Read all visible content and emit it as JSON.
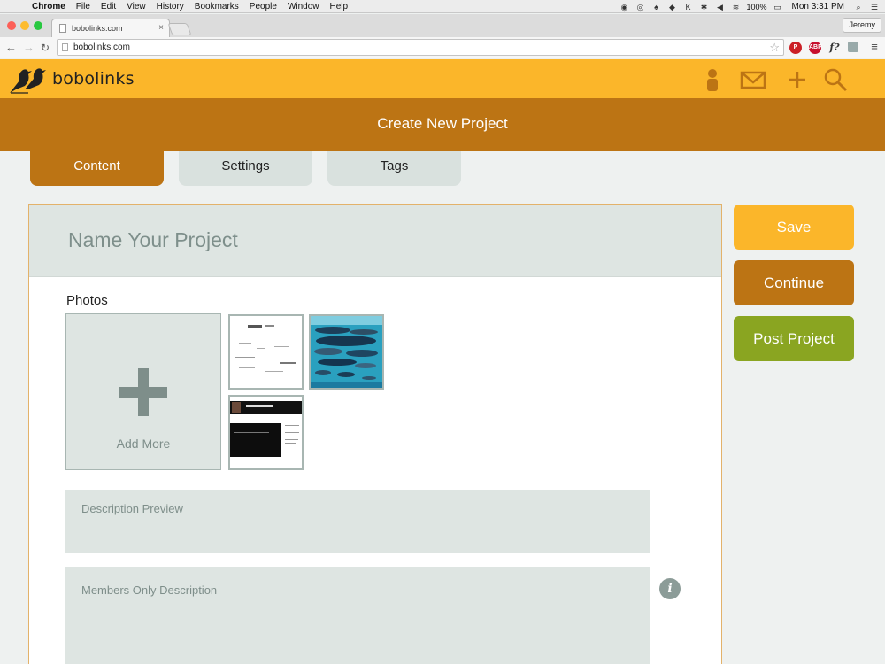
{
  "os_menubar": {
    "items": [
      "Chrome",
      "File",
      "Edit",
      "View",
      "History",
      "Bookmarks",
      "People",
      "Window",
      "Help"
    ],
    "battery": "100%",
    "clock": "Mon 3:31 PM"
  },
  "browser": {
    "tab_title": "bobolinks.com",
    "profile": "Jeremy",
    "url": "bobolinks.com"
  },
  "site": {
    "logo_text": "bobolinks",
    "page_title": "Create New Project",
    "tabs": [
      "Content",
      "Settings",
      "Tags"
    ],
    "active_tab": "Content",
    "name_placeholder": "Name Your Project",
    "photos_label": "Photos",
    "add_more_label": "Add More",
    "description_preview_placeholder": "Description Preview",
    "members_description_placeholder": "Members Only Description",
    "buttons": {
      "save": "Save",
      "continue": "Continue",
      "post": "Post Project"
    }
  },
  "colors": {
    "header_yellow": "#fbb62a",
    "brand_brown": "#bc7414",
    "post_green": "#8aa521",
    "field_gray": "#dee5e2"
  }
}
